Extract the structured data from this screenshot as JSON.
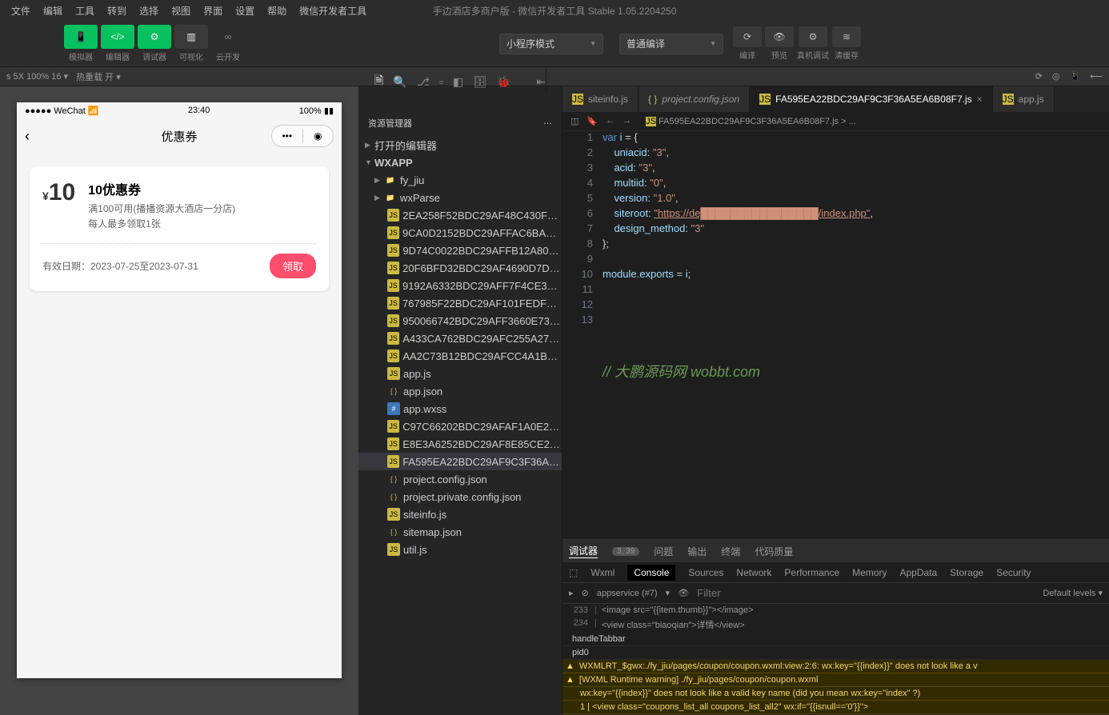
{
  "menubar": {
    "items": [
      "文件",
      "编辑",
      "工具",
      "转到",
      "选择",
      "视图",
      "界面",
      "设置",
      "帮助",
      "微信开发者工具"
    ]
  },
  "title": "手边酒店多商户版 - 微信开发者工具 Stable 1.05.2204250",
  "toolbar": {
    "buttons": [
      "模拟器",
      "编辑器",
      "调试器",
      "可视化",
      "云开发"
    ],
    "mode": "小程序模式",
    "compile": "普通编译",
    "actions": [
      "编译",
      "预览",
      "真机调试",
      "清缓存"
    ]
  },
  "status": {
    "left": "s 5X 100% 16 ▾",
    "hot": "热重载 开 ▾"
  },
  "phone": {
    "carrier": "WeChat",
    "time": "23:40",
    "battery": "100%",
    "title": "优惠券",
    "coupon": {
      "amount": "10",
      "name": "10优惠券",
      "cond1": "满100可用(播播资源大酒店一分店)",
      "cond2": "每人最多领取1张",
      "validity": "有效日期：2023-07-25至2023-07-31",
      "btn": "领取"
    }
  },
  "explorer": {
    "title": "资源管理器",
    "open_editors": "打开的编辑器",
    "root": "WXAPP",
    "folders": [
      "fy_jiu",
      "wxParse"
    ],
    "files": [
      "2EA258F52BDC29AF48C430F2D...",
      "9CA0D2152BDC29AFFAC6BA12E...",
      "9D74C0022BDC29AFFB12A8050...",
      "20F6BFD32BDC29AF4690D7D4B...",
      "9192A6332BDC29AFF7F4CE3453...",
      "767985F22BDC29AF101FEDF571...",
      "950066742BDC29AFF3660E7331...",
      "A433CA762BDC29AFC255A2714...",
      "AA2C73B12BDC29AFCC4A1BB6...",
      "app.js",
      "app.json",
      "app.wxss",
      "C97C66202BDC29AFAF1A0E274...",
      "E8E3A6252BDC29AF8E85CE226...",
      "FA595EA22BDC29AF9C3F36A5E...",
      "project.config.json",
      "project.private.config.json",
      "siteinfo.js",
      "sitemap.json",
      "util.js"
    ],
    "sel_index": 14
  },
  "tabs": [
    {
      "label": "siteinfo.js",
      "icon": "js"
    },
    {
      "label": "project.config.json",
      "icon": "json",
      "italic": true
    },
    {
      "label": "FA595EA22BDC29AF9C3F36A5EA6B08F7.js",
      "icon": "js",
      "active": true
    },
    {
      "label": "app.js",
      "icon": "js"
    }
  ],
  "breadcrumb": "FA595EA22BDC29AF9C3F36A5EA6B08F7.js > ...",
  "code": {
    "lines": [
      {
        "n": 1,
        "segs": [
          [
            "k",
            "var "
          ],
          [
            "p",
            "i"
          ],
          [
            "o",
            " = {"
          ]
        ]
      },
      {
        "n": 2,
        "segs": [
          [
            "o",
            "    "
          ],
          [
            "p",
            "uniacid"
          ],
          [
            "o",
            ": "
          ],
          [
            "s",
            "\"3\""
          ],
          [
            "o",
            ","
          ]
        ]
      },
      {
        "n": 3,
        "segs": [
          [
            "o",
            "    "
          ],
          [
            "p",
            "acid"
          ],
          [
            "o",
            ": "
          ],
          [
            "s",
            "\"3\""
          ],
          [
            "o",
            ","
          ]
        ]
      },
      {
        "n": 4,
        "segs": [
          [
            "o",
            "    "
          ],
          [
            "p",
            "multiid"
          ],
          [
            "o",
            ": "
          ],
          [
            "s",
            "\"0\""
          ],
          [
            "o",
            ","
          ]
        ]
      },
      {
        "n": 5,
        "segs": [
          [
            "o",
            "    "
          ],
          [
            "p",
            "version"
          ],
          [
            "o",
            ": "
          ],
          [
            "s",
            "\"1.0\""
          ],
          [
            "o",
            ","
          ]
        ]
      },
      {
        "n": 6,
        "segs": [
          [
            "o",
            "    "
          ],
          [
            "p",
            "siteroot"
          ],
          [
            "o",
            ": "
          ],
          [
            "url",
            "\"https://de████████████████/index.php\""
          ],
          [
            "o",
            ","
          ]
        ]
      },
      {
        "n": 7,
        "segs": [
          [
            "o",
            "    "
          ],
          [
            "p",
            "design_method"
          ],
          [
            "o",
            ": "
          ],
          [
            "s",
            "\"3\""
          ]
        ]
      },
      {
        "n": 8,
        "segs": [
          [
            "o",
            "};"
          ]
        ]
      },
      {
        "n": 9,
        "segs": []
      },
      {
        "n": 10,
        "segs": [
          [
            "p",
            "module"
          ],
          [
            "o",
            "."
          ],
          [
            "p",
            "exports"
          ],
          [
            "o",
            " = "
          ],
          [
            "p",
            "i"
          ],
          [
            "o",
            ";"
          ]
        ]
      },
      {
        "n": 11,
        "segs": []
      },
      {
        "n": 12,
        "segs": []
      },
      {
        "n": 13,
        "segs": []
      }
    ],
    "watermark": "// 大鹏源码网 wobbt.com"
  },
  "lower": {
    "tabs": [
      "调试器",
      "问题",
      "输出",
      "终端",
      "代码质量"
    ],
    "badge": "3, 39",
    "devtools": [
      "Wxml",
      "Console",
      "Sources",
      "Network",
      "Performance",
      "Memory",
      "AppData",
      "Storage",
      "Security"
    ],
    "context": "appservice (#7)",
    "filter": "Filter",
    "levels": "Default levels ▾",
    "lines": [
      {
        "type": "code",
        "ln": "233",
        "html": "    <image src=\"{{item.thumb}}\"></image>"
      },
      {
        "type": "code",
        "ln": "234",
        "html": "    <view class=\"biaoqian\">详情</view>"
      },
      {
        "type": "info",
        "text": "handleTabbar"
      },
      {
        "type": "info",
        "text": "pid0"
      },
      {
        "type": "warn",
        "text": "WXMLRT_$gwx:./fy_jiu/pages/coupon/coupon.wxml:view:2:6: wx:key=\"{{index}}\" does not look like a v"
      },
      {
        "type": "warn",
        "text": "[WXML Runtime warning] ./fy_jiu/pages/coupon/coupon.wxml"
      },
      {
        "type": "warn-sub",
        "text": " wx:key=\"{{index}}\" does not look like a valid key name (did you mean wx:key=\"index\" ?)"
      },
      {
        "type": "warn-sub",
        "text": "  1 | <view class=\"coupons_list_all coupons_list_all2\" wx:if=\"{{isnull=='0'}}\">"
      }
    ]
  }
}
